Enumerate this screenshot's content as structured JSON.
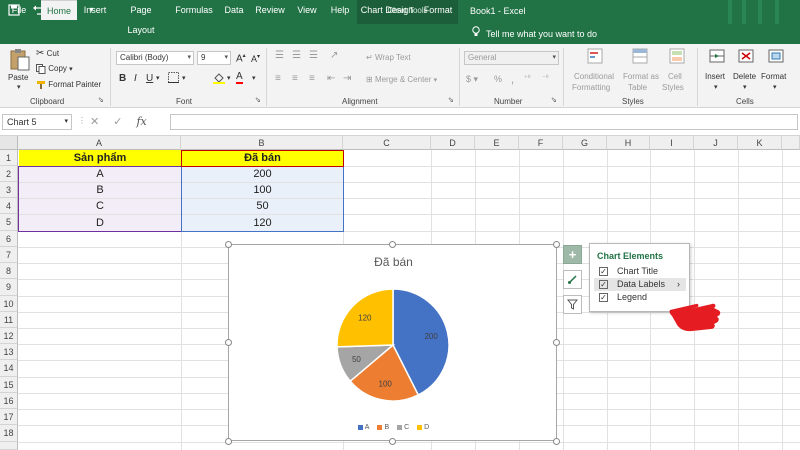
{
  "window": {
    "context_tab_group": "Chart Tools",
    "document_title": "Book1 - Excel"
  },
  "tabs": [
    {
      "label": "File"
    },
    {
      "label": "Home"
    },
    {
      "label": "Insert"
    },
    {
      "label": "Page Layout"
    },
    {
      "label": "Formulas"
    },
    {
      "label": "Data"
    },
    {
      "label": "Review"
    },
    {
      "label": "View"
    },
    {
      "label": "Help"
    },
    {
      "label": "Chart Design"
    },
    {
      "label": "Format"
    }
  ],
  "tell_me": "Tell me what you want to do",
  "ribbon": {
    "clipboard": {
      "paste": "Paste",
      "cut": "Cut",
      "copy": "Copy",
      "format_painter": "Format Painter",
      "label": "Clipboard"
    },
    "font": {
      "font_name": "Calibri (Body)",
      "font_size": "9",
      "label": "Font"
    },
    "alignment": {
      "wrap_text": "Wrap Text",
      "merge_center": "Merge & Center",
      "label": "Alignment"
    },
    "number": {
      "format": "General",
      "label": "Number"
    },
    "styles": {
      "conditional_formatting_1": "Conditional",
      "conditional_formatting_2": "Formatting",
      "format_as_table_1": "Format as",
      "format_as_table_2": "Table",
      "cell_styles_1": "Cell",
      "cell_styles_2": "Styles",
      "label": "Styles"
    },
    "cells": {
      "insert": "Insert",
      "delete": "Delete",
      "format": "Format",
      "label": "Cells"
    }
  },
  "formula_bar": {
    "name_box": "Chart 5",
    "fx": "fx",
    "value": ""
  },
  "columns": [
    "A",
    "B",
    "C",
    "D",
    "E",
    "F",
    "G",
    "H",
    "I",
    "J",
    "K"
  ],
  "rows": [
    "1",
    "2",
    "3",
    "4",
    "5",
    "6",
    "7",
    "8",
    "9",
    "10",
    "11",
    "12",
    "13",
    "14",
    "15",
    "16",
    "17",
    "18"
  ],
  "table": {
    "header": [
      "Sản phẩm",
      "Đã bán"
    ],
    "rows": [
      [
        "A",
        "200"
      ],
      [
        "B",
        "100"
      ],
      [
        "C",
        "50"
      ],
      [
        "D",
        "120"
      ]
    ]
  },
  "chart_data": {
    "type": "pie",
    "title": "Đã bán",
    "categories": [
      "A",
      "B",
      "C",
      "D"
    ],
    "values": [
      200,
      100,
      50,
      120
    ],
    "colors": [
      "#4472c4",
      "#ed7d31",
      "#a5a5a5",
      "#ffc000"
    ],
    "data_labels": [
      "200",
      "100",
      "50",
      "120"
    ],
    "legend_position": "bottom"
  },
  "chart_elements": {
    "title": "Chart Elements",
    "items": [
      {
        "label": "Chart Title",
        "checked": true
      },
      {
        "label": "Data Labels",
        "checked": true
      },
      {
        "label": "Legend",
        "checked": true
      }
    ],
    "check_glyph": "✓",
    "submenu_arrow": "›"
  },
  "side_buttons": {
    "chart_elements": "+",
    "chart_styles": "brush-icon",
    "chart_filters": "filter-icon"
  }
}
